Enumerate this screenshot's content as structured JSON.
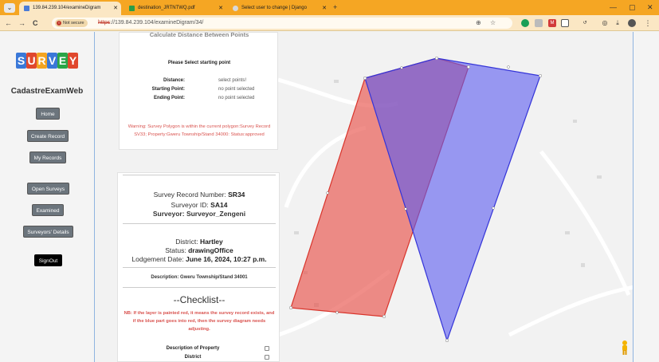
{
  "browser": {
    "tabs": [
      {
        "title": "139.84.239.104/examineDigram",
        "active": true
      },
      {
        "title": "destination_JRTNTWQ.pdf",
        "active": false
      },
      {
        "title": "Select user to change | Django",
        "active": false
      }
    ],
    "new_tab": "+",
    "url_scheme": "https",
    "url_rest": "://139.84.239.104/examineDigram/34/",
    "security_label": "Not secure"
  },
  "sidebar": {
    "logo_letters": [
      "S",
      "U",
      "R",
      "V",
      "E",
      "Y"
    ],
    "app_name": "CadastreExamWeb",
    "buttons": {
      "home": "Home",
      "create_record": "Create Record",
      "my_records": "My Records",
      "open_surveys": "Open Surveys",
      "examined": "Examined",
      "surveyors_details": "Surveyors' Details",
      "signout": "SignOut"
    }
  },
  "distance_panel": {
    "title": "Calculate Distance Between Points",
    "select_title": "Please Select starting point",
    "rows": [
      {
        "label": "Distance:",
        "value": "select points!"
      },
      {
        "label": "Starting Point:",
        "value": "no point selected"
      },
      {
        "label": "Ending Point:",
        "value": "no point selected"
      }
    ],
    "warning": "Warning: Survey Polygon is within the current polygon:Survey Record SV33; Property:Gweru Township/Stand 34000: Status:approved"
  },
  "record": {
    "number_label": "Survey Record Number:",
    "number": "SR34",
    "surveyor_id_label": "Surveyor ID:",
    "surveyor_id": "SA14",
    "surveyor_label": "Surveyor:",
    "surveyor": "Surveyor_Zengeni",
    "district_label": "District:",
    "district": "Hartley",
    "status_label": "Status:",
    "status": "drawingOffice",
    "lodgement_label": "Lodgement Date:",
    "lodgement": "June 16, 2024, 10:27 p.m.",
    "description_label": "Description:",
    "description": "Gweru Township/Stand 34001"
  },
  "checklist": {
    "title": "--Checklist--",
    "nb": "NB: If the layer is painted red, it means the survey record exists, and if the blue part goes into red, then the survey diagram needs adjusting.",
    "items": [
      "Description of Property",
      "District"
    ]
  },
  "colors": {
    "tabbar": "#f5a623",
    "red_polygon": "#e8524a",
    "blue_polygon": "#5a5af0",
    "warning_text": "#d9534f"
  },
  "icons": {
    "back": "←",
    "forward": "→",
    "reload": "C",
    "zoom": "⊕",
    "star": "☆",
    "minimize": "—",
    "restore": "▢",
    "close": "✕"
  }
}
